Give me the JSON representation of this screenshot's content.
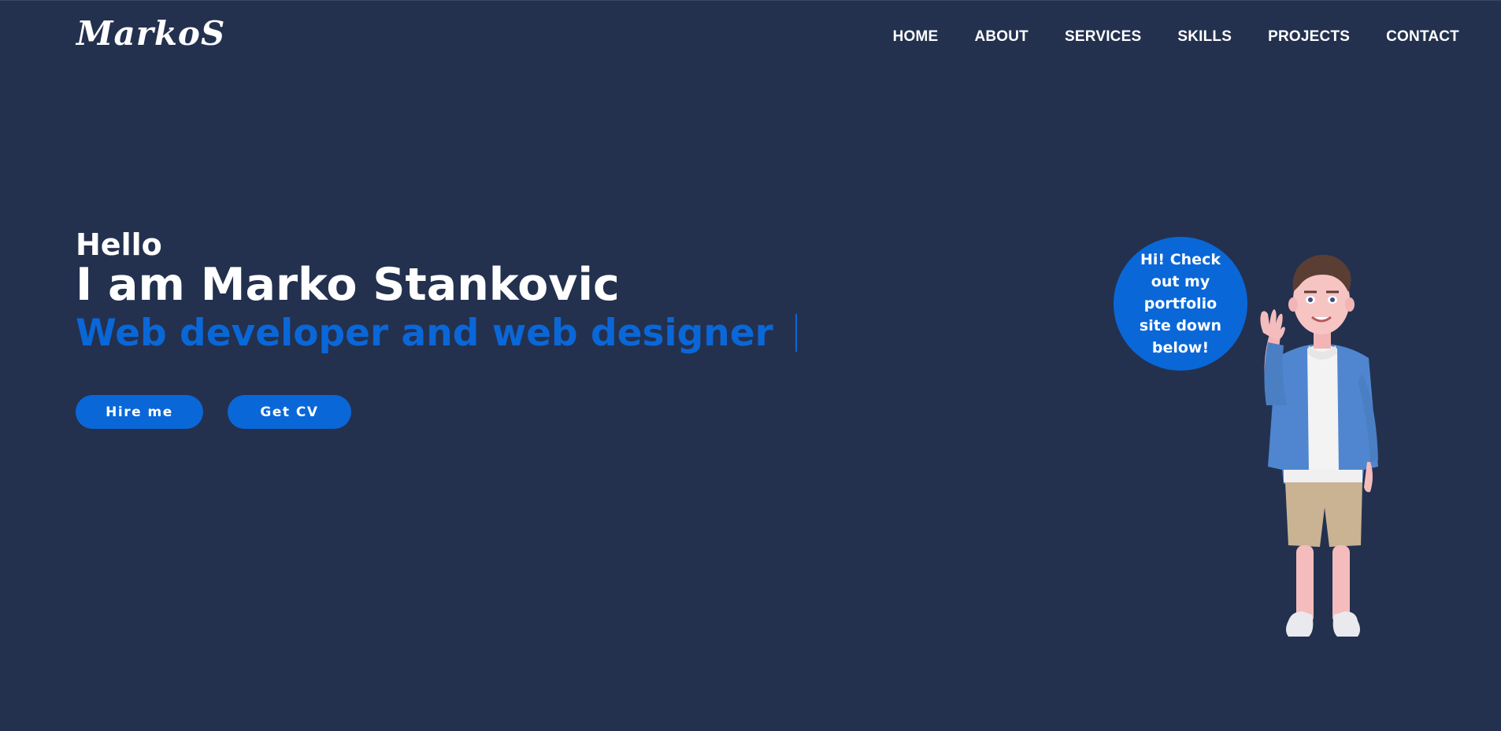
{
  "brand": {
    "logo_text": "MarkoS"
  },
  "nav": {
    "items": [
      {
        "label": "HOME"
      },
      {
        "label": "ABOUT"
      },
      {
        "label": "SERVICES"
      },
      {
        "label": "SKILLS"
      },
      {
        "label": "PROJECTS"
      },
      {
        "label": "CONTACT"
      }
    ]
  },
  "hero": {
    "greeting": "Hello",
    "name": "I am Marko Stankovic",
    "role": "Web developer and web designer",
    "buttons": {
      "hire": "Hire me",
      "cv": "Get CV"
    }
  },
  "bubble": {
    "text": "Hi! Check out my portfolio site down below!"
  },
  "colors": {
    "background": "#23314f",
    "accent": "#0a67d8",
    "text": "#ffffff"
  }
}
